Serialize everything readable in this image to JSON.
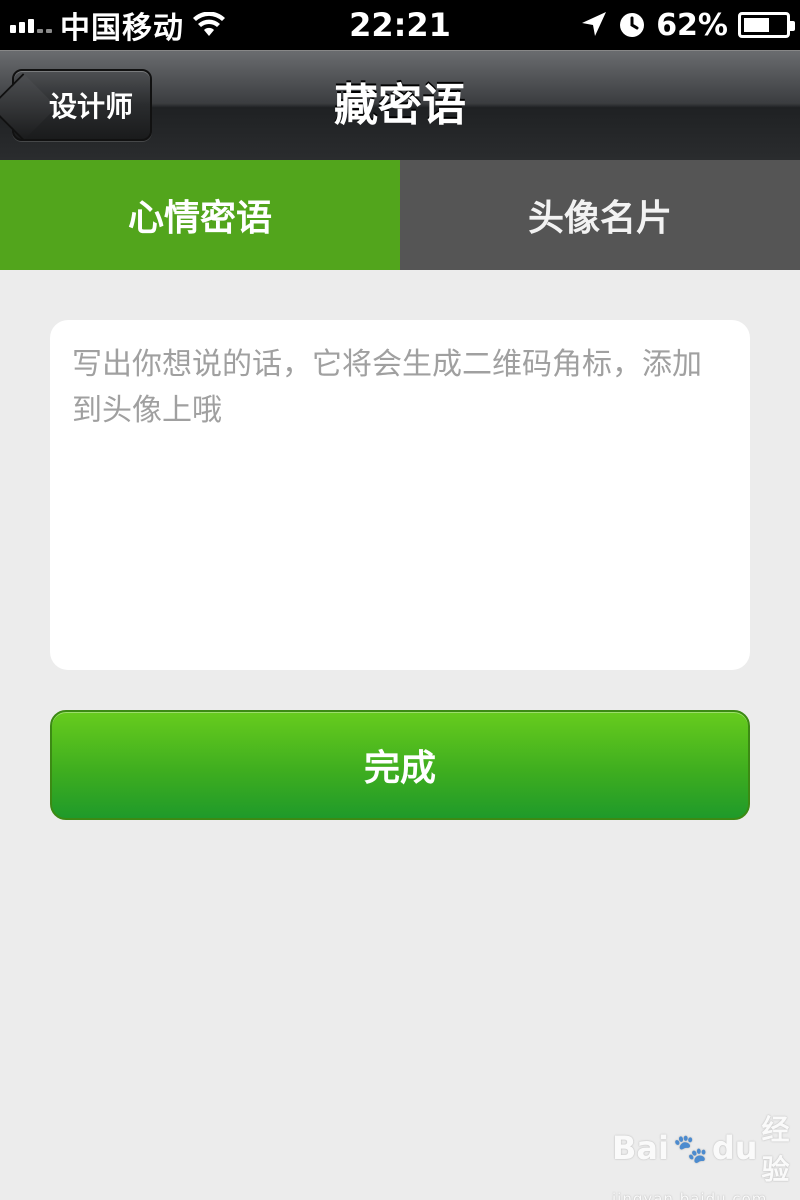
{
  "status_bar": {
    "carrier": "中国移动",
    "time": "22:21",
    "battery_percent": "62%",
    "battery_level": 0.62,
    "icons": [
      "signal-bars-icon",
      "wifi-icon",
      "location-arrow-icon",
      "alarm-clock-icon",
      "battery-charging-icon"
    ]
  },
  "nav": {
    "back_label": "设计师",
    "title": "藏密语"
  },
  "tabs": [
    {
      "label": "心情密语",
      "active": true
    },
    {
      "label": "头像名片",
      "active": false
    }
  ],
  "message": {
    "value": "",
    "placeholder": "写出你想说的话，它将会生成二维码角标，添加到头像上哦"
  },
  "done_button": {
    "label": "完成"
  },
  "watermark": {
    "brand_left": "Bai",
    "brand_right": "du",
    "product": "经验",
    "url": "jingyan.baidu.com"
  },
  "colors": {
    "tab_active": "#52a51c",
    "tab_inactive": "#555555",
    "button_green": "#3fae1f",
    "background": "#ececec"
  }
}
